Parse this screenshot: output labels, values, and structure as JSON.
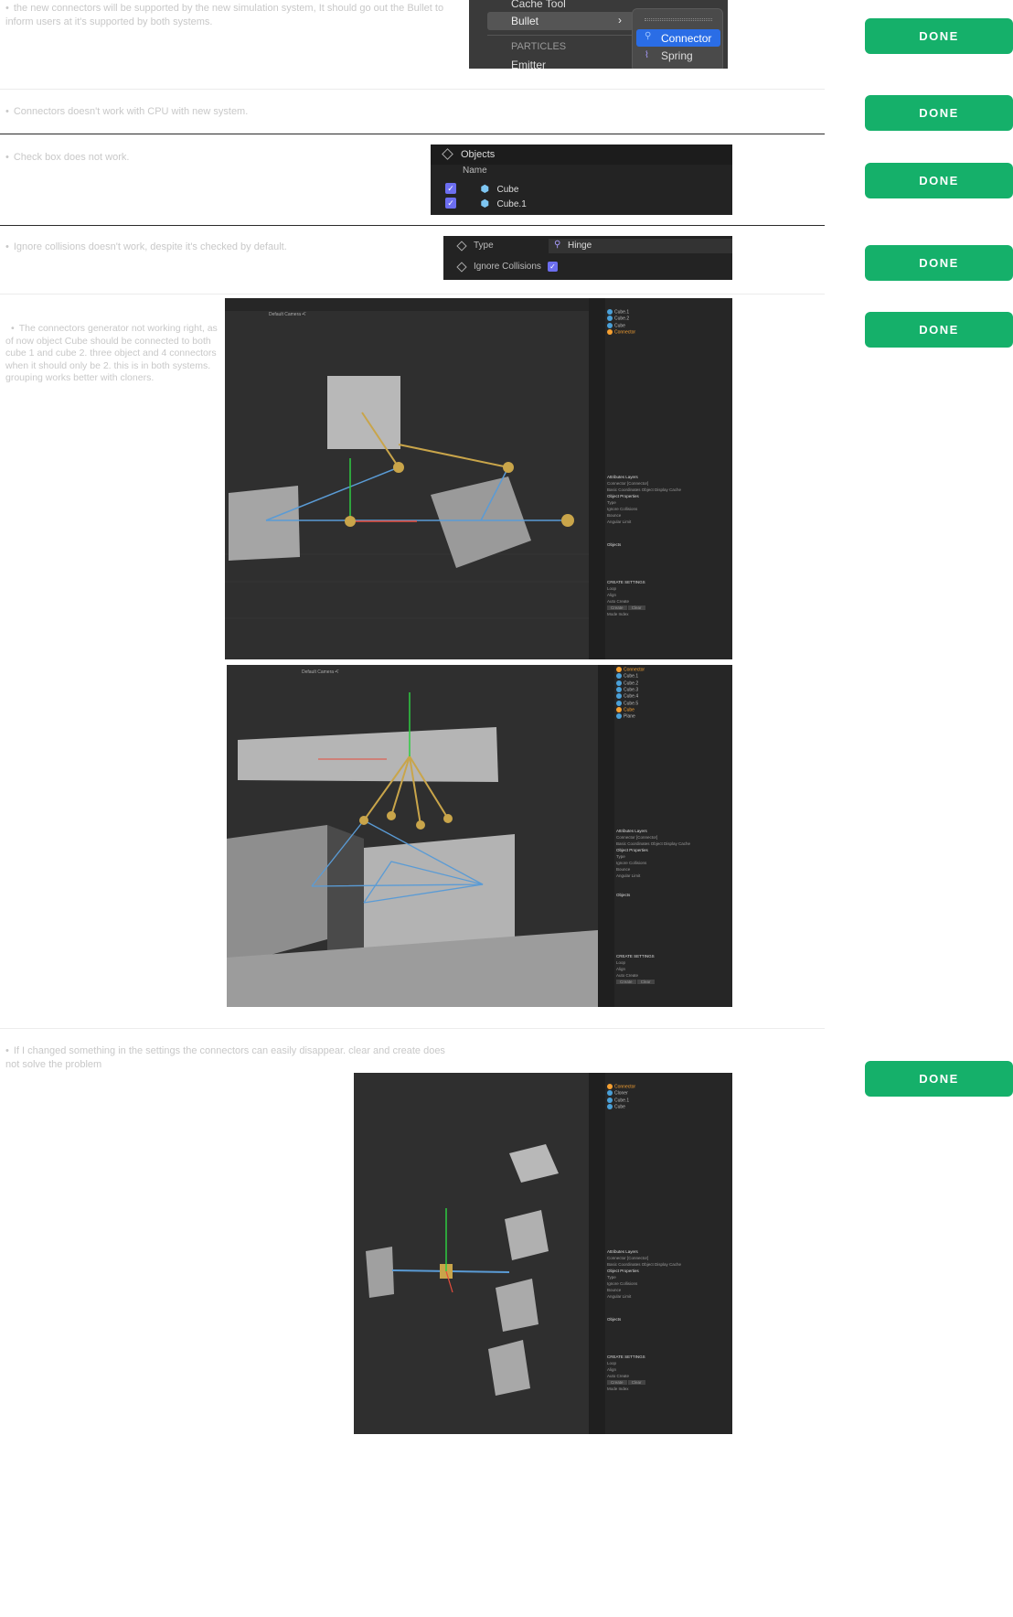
{
  "colors": {
    "done": "#15b06a",
    "accent": "#2a6de6",
    "check": "#6c6ef0",
    "c4d_bg": "#2f2f2f",
    "connector_gold": "#c9a54a",
    "connector_blue": "#5a9bd5"
  },
  "done_label": "DONE",
  "issues": [
    {
      "text": "the new connectors will be supported by the new simulation system, It should go out the Bullet to inform users at it's supported by both systems."
    },
    {
      "text": "Connectors doesn't work with CPU with new system."
    },
    {
      "text": "Check box does not work."
    },
    {
      "text": "Ignore collisions doesn't work, despite it's checked by default."
    },
    {
      "text": "The connectors generator not working right, as of now object Cube should be connected to both cube 1 and cube 2. three object and 4 connectors when it should only be 2. this is in both systems. grouping works better with cloners."
    },
    {
      "text": "If I changed something in the settings the connectors can easily disappear. clear and create does not solve the problem"
    }
  ],
  "menu": {
    "cache_tool": "Cache Tool",
    "bullet": "Bullet",
    "particles": "PARTICLES",
    "emitter": "Emitter",
    "connector": "Connector",
    "spring": "Spring"
  },
  "objects_panel": {
    "title": "Objects",
    "col": "Name",
    "items": [
      "Cube",
      "Cube.1"
    ]
  },
  "attr_panel": {
    "type_label": "Type",
    "type_value": "Hinge",
    "ignore_label": "Ignore Collisions"
  },
  "c4d": {
    "camera": "Default Camera •ʕ",
    "obj1": [
      "Cube.1",
      "Cube.2",
      "Cube",
      "Connector"
    ],
    "obj2": [
      "Connector",
      "Cube.1",
      "Cube.2",
      "Cube.3",
      "Cube.4",
      "Cube.5",
      "Cube",
      "Plane"
    ],
    "obj3": [
      "Connector",
      "Cloner",
      "Cube.1",
      "Cube"
    ],
    "attr_head": "Attributes  Layers",
    "attr_title": "Connector [Connector]",
    "attr_tabs": "Basic  Coordinates  Object  Display  Cache",
    "obj_props": "Object Properties",
    "rows": [
      "Type",
      "Ignore Collisions",
      "Bounce",
      "Angular Limit"
    ],
    "hinge": "Hinge",
    "objects": "Objects",
    "create": "CREATE SETTINGS",
    "create_rows": [
      "Loop",
      "Align",
      "Auto Create"
    ],
    "create_btn": "Create",
    "clear_btn": "Clear",
    "mode": "Mode  Index"
  }
}
